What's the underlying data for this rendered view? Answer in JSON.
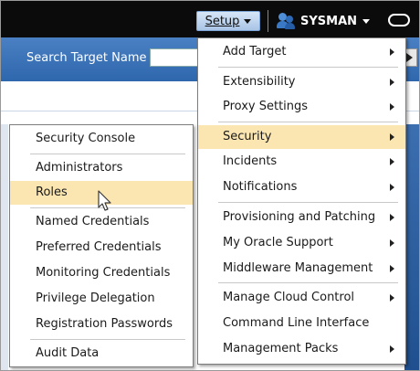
{
  "topbar": {
    "setup_label": "Setup",
    "user_label": "SYSMAN"
  },
  "search": {
    "label": "Search Target Name",
    "value": ""
  },
  "setup_menu": {
    "items": [
      {
        "label": "Add Target",
        "submenu": true
      },
      {
        "label": "Extensibility",
        "submenu": true
      },
      {
        "label": "Proxy Settings",
        "submenu": true
      },
      {
        "label": "Security",
        "submenu": true,
        "highlighted": true
      },
      {
        "label": "Incidents",
        "submenu": true
      },
      {
        "label": "Notifications",
        "submenu": true
      },
      {
        "label": "Provisioning and Patching",
        "submenu": true
      },
      {
        "label": "My Oracle Support",
        "submenu": true
      },
      {
        "label": "Middleware Management",
        "submenu": true
      },
      {
        "label": "Manage Cloud Control",
        "submenu": true
      },
      {
        "label": "Command Line Interface",
        "submenu": false
      },
      {
        "label": "Management Packs",
        "submenu": true
      }
    ]
  },
  "security_menu": {
    "items": [
      {
        "label": "Security Console"
      },
      {
        "label": "Administrators"
      },
      {
        "label": "Roles",
        "highlighted": true
      },
      {
        "label": "Named Credentials"
      },
      {
        "label": "Preferred Credentials"
      },
      {
        "label": "Monitoring Credentials"
      },
      {
        "label": "Privilege Delegation"
      },
      {
        "label": "Registration Passwords"
      },
      {
        "label": "Audit Data"
      }
    ]
  },
  "icons": {
    "user": "users-icon",
    "oval": "oval-icon",
    "cursor": "mouse-pointer-icon",
    "submenu": "submenu-arrow-icon"
  },
  "colors": {
    "highlight": "#fbe6b2",
    "topbar": "#0b0b0b",
    "searchband": "#3a72b8"
  }
}
